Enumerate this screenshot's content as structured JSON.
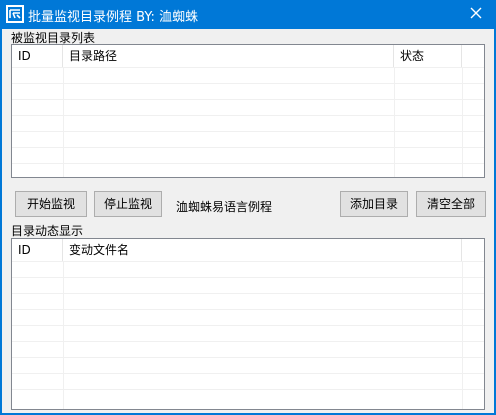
{
  "window": {
    "title": "批量监视目录例程 BY: 洫蜘蛛",
    "icon": "app-logo-icon",
    "close_icon": "close-icon"
  },
  "monitor_list": {
    "label": "被监视目录列表",
    "columns": [
      "ID",
      "目录路径",
      "状态"
    ],
    "rows": []
  },
  "toolbar": {
    "start_label": "开始监视",
    "stop_label": "停止监视",
    "caption": "洫蜘蛛易语言例程",
    "add_label": "添加目录",
    "clear_label": "清空全部"
  },
  "change_list": {
    "label": "目录动态显示",
    "columns": [
      "ID",
      "变动文件名"
    ],
    "rows": []
  },
  "colors": {
    "titlebar": "#0078d7",
    "client_bg": "#f0f0f0",
    "button_bg": "#e1e1e1"
  }
}
